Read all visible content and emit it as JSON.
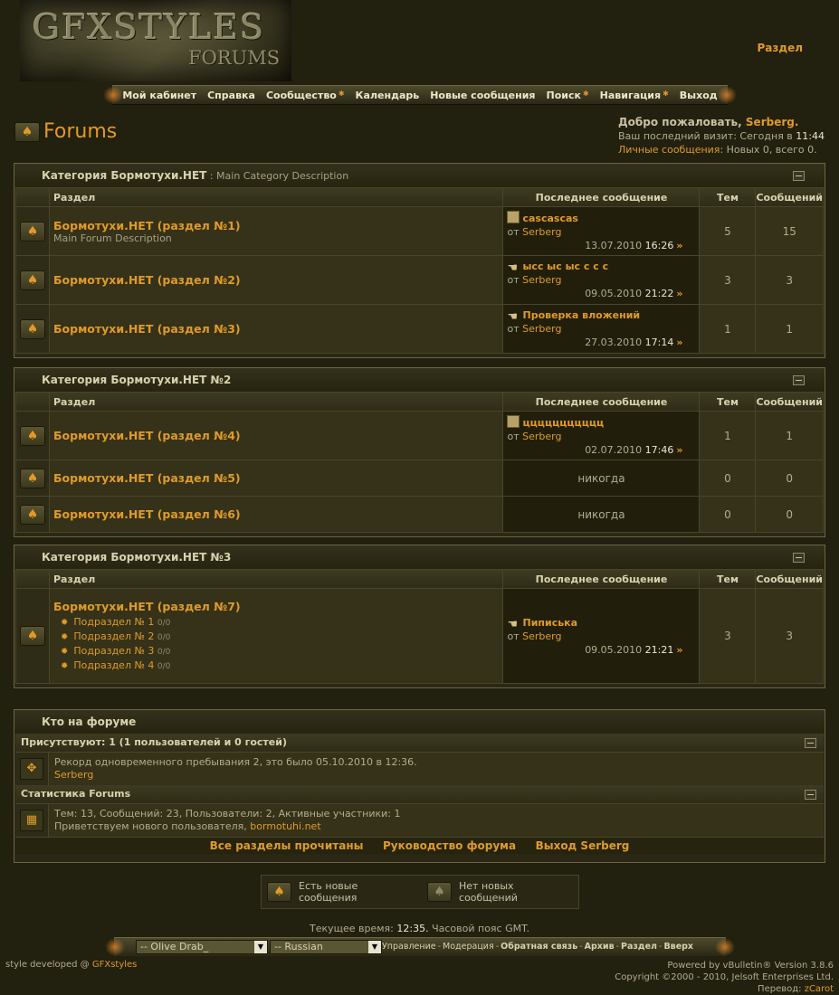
{
  "header": {
    "logo_title": "GFXSTYLES",
    "logo_subtitle": "FORUMS",
    "top_link": "Раздел"
  },
  "nav": [
    {
      "label": "Мой кабинет",
      "dropdown": false
    },
    {
      "label": "Справка",
      "dropdown": false
    },
    {
      "label": "Сообщество",
      "dropdown": true
    },
    {
      "label": "Календарь",
      "dropdown": false
    },
    {
      "label": "Новые сообщения",
      "dropdown": false
    },
    {
      "label": "Поиск",
      "dropdown": true
    },
    {
      "label": "Навигация",
      "dropdown": true
    },
    {
      "label": "Выход",
      "dropdown": false
    }
  ],
  "page_title": "Forums",
  "welcome": {
    "greeting": "Добро пожаловать,",
    "user": "Serberg.",
    "last_visit_label": "Ваш последний визит: Сегодня в",
    "last_visit_time": "11:44",
    "pm_label": "Личные сообщения",
    "pm_text": ": Новых 0, всего 0."
  },
  "columns": {
    "forum": "Раздел",
    "last_post": "Последнее сообщение",
    "threads": "Тем",
    "posts": "Сообщений"
  },
  "categories": [
    {
      "title": "Категория Бормотухи.НЕТ",
      "description": " : Main Category Description",
      "forums": [
        {
          "name": "Бормотухи.НЕТ (раздел №1)",
          "description": "Main Forum Description",
          "last_title": "cascascas",
          "by": "от",
          "user": "Serberg",
          "date": "13.07.2010",
          "time": "16:26",
          "threads": "5",
          "posts": "15"
        },
        {
          "name": "Бормотухи.НЕТ (раздел №2)",
          "description": "",
          "last_title": "ысс ыс ыс с с с",
          "by": "от",
          "user": "Serberg",
          "date": "09.05.2010",
          "time": "21:22",
          "threads": "3",
          "posts": "3"
        },
        {
          "name": "Бормотухи.НЕТ (раздел №3)",
          "description": "",
          "last_title": "Проверка вложений",
          "by": "от",
          "user": "Serberg",
          "date": "27.03.2010",
          "time": "17:14",
          "threads": "1",
          "posts": "1"
        }
      ]
    },
    {
      "title": "Категория Бормотухи.НЕТ №2",
      "description": "",
      "forums": [
        {
          "name": "Бормотухи.НЕТ (раздел №4)",
          "last_title": "ццццццццццц",
          "by": "от",
          "user": "Serberg",
          "date": "02.07.2010",
          "time": "17:46",
          "threads": "1",
          "posts": "1"
        },
        {
          "name": "Бормотухи.НЕТ (раздел №5)",
          "never": "никогда",
          "threads": "0",
          "posts": "0"
        },
        {
          "name": "Бормотухи.НЕТ (раздел №6)",
          "never": "никогда",
          "threads": "0",
          "posts": "0"
        }
      ]
    },
    {
      "title": "Категория Бормотухи.НЕТ №3",
      "description": "",
      "forums": [
        {
          "name": "Бормотухи.НЕТ (раздел №7)",
          "subforums": [
            {
              "label": "Подраздел № 1",
              "count": "0/0"
            },
            {
              "label": "Подраздел № 2",
              "count": "0/0"
            },
            {
              "label": "Подраздел № 3",
              "count": "0/0"
            },
            {
              "label": "Подраздел № 4",
              "count": "0/0"
            }
          ],
          "last_title": "Пиписька",
          "by": "от",
          "user": "Serberg",
          "date": "09.05.2010",
          "time": "21:21",
          "threads": "3",
          "posts": "3"
        }
      ]
    }
  ],
  "online": {
    "title": "Кто на форуме",
    "present_label": "Присутствуют:",
    "present_value": "1 (1 пользователей и 0 гостей)",
    "record_text": "Рекорд одновременного пребывания 2, это было 05.10.2010 в 12:36.",
    "record_user": "Serberg",
    "stats_title": "Статистика Forums",
    "stats_text": "Тем: 13, Сообщений: 23, Пользователи: 2, Активные участники: 1",
    "welcome_new_label": "Приветствуем нового пользователя,",
    "welcome_new_user": "bormotuhi.net",
    "links": [
      "Все разделы прочитаны",
      "Руководство форума",
      "Выход Serberg"
    ]
  },
  "legend": {
    "new_posts": "Есть новые сообщения",
    "no_new_posts": "Нет новых сообщений"
  },
  "footer": {
    "time_label": "Текущее время:",
    "time_value": "12:35.",
    "tz": "Часовой пояс GMT.",
    "style_select": "-- Olive Drab_",
    "lang_select": "-- Russian",
    "links": [
      "Управление",
      "Модерация",
      "Обратная связь",
      "Архив",
      "Раздел",
      "Вверх"
    ],
    "style_dev_label": "style developed @",
    "style_dev_name": "GFXstyles",
    "powered": "Powered by vBulletin® Version 3.8.6",
    "copyright": "Copyright ©2000 - 2010, Jelsoft Enterprises Ltd.",
    "translation_label": "Перевод:",
    "translation_name": "zCarot"
  },
  "colors": {
    "accent": "#e09a2a",
    "background": "#22200f",
    "panel": "#353219",
    "border": "#6e6440"
  },
  "icons": [
    "spade-forum-icon",
    "post-icon",
    "hand-post-icon",
    "go-to-last-post-icon",
    "collapse-icon",
    "online-users-icon",
    "stats-icon",
    "subforum-bullet-icon"
  ]
}
